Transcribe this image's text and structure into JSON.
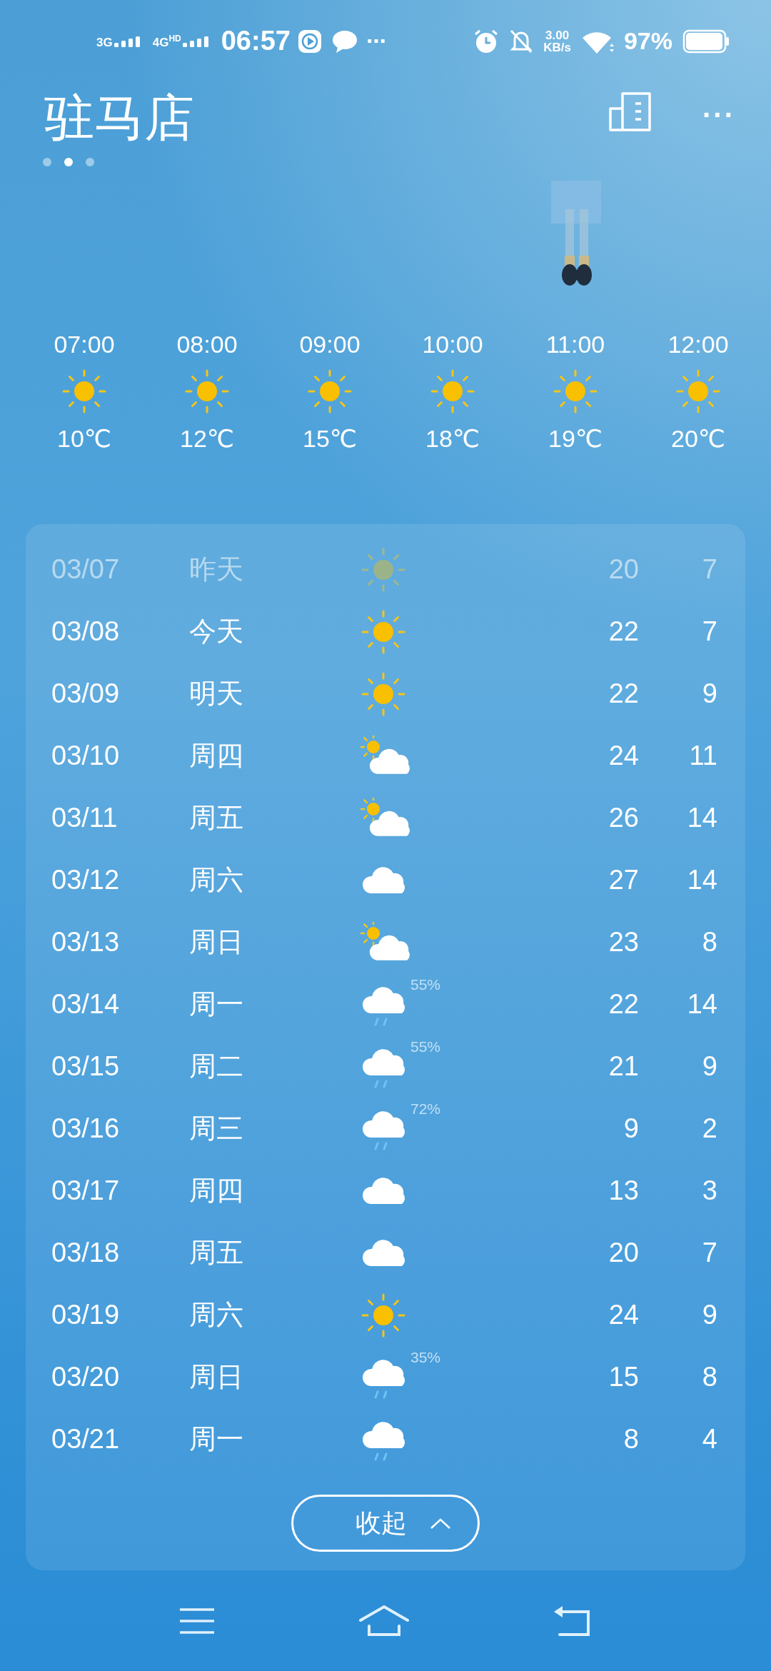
{
  "status_bar": {
    "networks": [
      {
        "label": "3G"
      },
      {
        "label": "4G",
        "hd": "HD"
      }
    ],
    "time": "06:57",
    "more": "···",
    "speed": "3.00",
    "speed_unit": "KB/s",
    "battery": "97%"
  },
  "header": {
    "city": "驻马店",
    "more": "···",
    "pages": [
      {
        "selected": false
      },
      {
        "selected": true
      },
      {
        "selected": false
      }
    ]
  },
  "hourly": [
    {
      "time": "07:00",
      "kind": "sunny",
      "temp": "10℃"
    },
    {
      "time": "08:00",
      "kind": "sunny",
      "temp": "12℃"
    },
    {
      "time": "09:00",
      "kind": "sunny",
      "temp": "15℃"
    },
    {
      "time": "10:00",
      "kind": "sunny",
      "temp": "18℃"
    },
    {
      "time": "11:00",
      "kind": "sunny",
      "temp": "19℃"
    },
    {
      "time": "12:00",
      "kind": "sunny",
      "temp": "20℃"
    }
  ],
  "daily": [
    {
      "date": "03/07",
      "day": "昨天",
      "kind": "sunny",
      "past": true,
      "high": "20",
      "low": "7"
    },
    {
      "date": "03/08",
      "day": "今天",
      "kind": "sunny",
      "past": false,
      "high": "22",
      "low": "7"
    },
    {
      "date": "03/09",
      "day": "明天",
      "kind": "sunny",
      "past": false,
      "high": "22",
      "low": "9"
    },
    {
      "date": "03/10",
      "day": "周四",
      "kind": "partly_cloudy",
      "past": false,
      "high": "24",
      "low": "11"
    },
    {
      "date": "03/11",
      "day": "周五",
      "kind": "partly_cloudy",
      "past": false,
      "high": "26",
      "low": "14"
    },
    {
      "date": "03/12",
      "day": "周六",
      "kind": "cloudy",
      "past": false,
      "high": "27",
      "low": "14"
    },
    {
      "date": "03/13",
      "day": "周日",
      "kind": "partly_cloudy",
      "past": false,
      "high": "23",
      "low": "8"
    },
    {
      "date": "03/14",
      "day": "周一",
      "kind": "rain",
      "rain_chance": "55%",
      "past": false,
      "high": "22",
      "low": "14"
    },
    {
      "date": "03/15",
      "day": "周二",
      "kind": "rain",
      "rain_chance": "55%",
      "past": false,
      "high": "21",
      "low": "9"
    },
    {
      "date": "03/16",
      "day": "周三",
      "kind": "rain",
      "rain_chance": "72%",
      "past": false,
      "high": "9",
      "low": "2"
    },
    {
      "date": "03/17",
      "day": "周四",
      "kind": "cloudy",
      "past": false,
      "high": "13",
      "low": "3"
    },
    {
      "date": "03/18",
      "day": "周五",
      "kind": "cloudy",
      "past": false,
      "high": "20",
      "low": "7"
    },
    {
      "date": "03/19",
      "day": "周六",
      "kind": "sunny",
      "past": false,
      "high": "24",
      "low": "9"
    },
    {
      "date": "03/20",
      "day": "周日",
      "kind": "rain",
      "rain_chance": "35%",
      "past": false,
      "high": "15",
      "low": "8"
    },
    {
      "date": "03/21",
      "day": "周一",
      "kind": "rain",
      "past": false,
      "high": "8",
      "low": "4"
    }
  ],
  "collapse_button": "收起"
}
